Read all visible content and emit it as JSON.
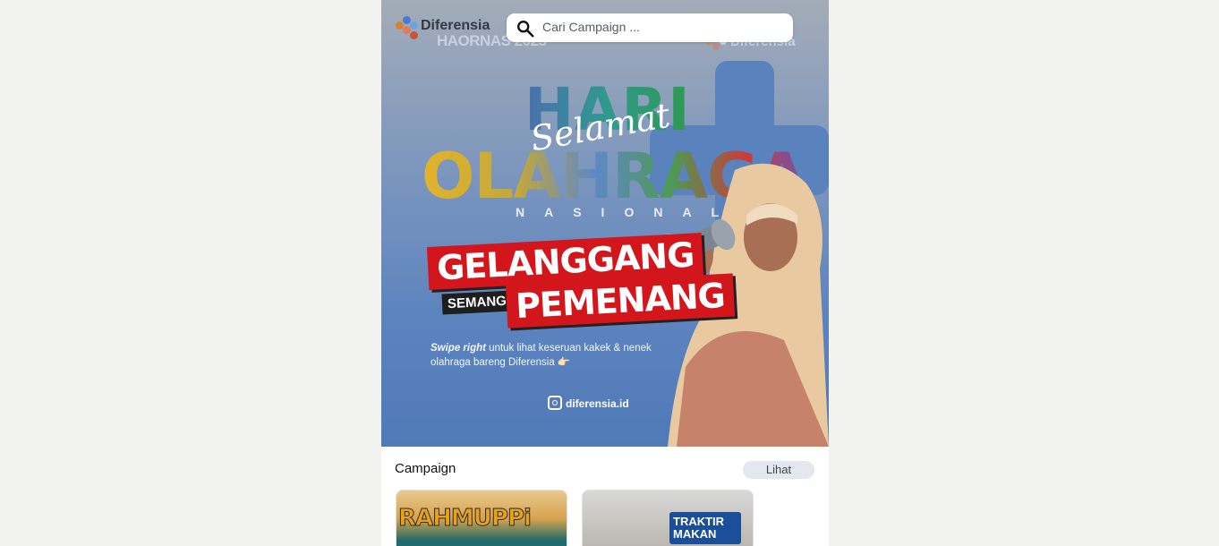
{
  "brand": {
    "name": "Diferensia",
    "banner_tag": "HAORNAS 2023",
    "watermark": "Diferensia"
  },
  "search": {
    "placeholder": "Cari Campaign ..."
  },
  "banner": {
    "line1": "HARI",
    "script": "Selamat",
    "line2": "OLAHRAGA",
    "line3": "NASIONAL",
    "tag1": "GELANGGANG",
    "tag2": "SEMANGAT",
    "tag3": "PEMENANG",
    "swipe_bold": "Swipe right",
    "swipe_text": " untuk lihat keseruan kakek & nenek olahraga bareng Diferensia 👉🏻",
    "instagram": "diferensia.id"
  },
  "section": {
    "title": "Campaign",
    "see_all": "Lihat"
  },
  "cards": [
    {
      "title": "RAHMUPPi"
    },
    {
      "title": "TRAKTIR MAKAN"
    }
  ]
}
